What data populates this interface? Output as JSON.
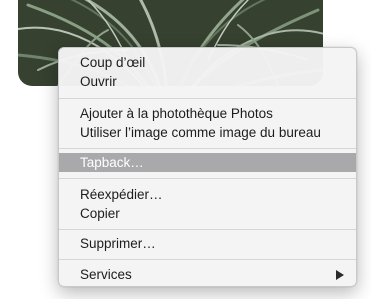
{
  "photo": {
    "icon": "plant-photo-thumbnail",
    "colors": {
      "dark": "#2f3a2a",
      "leaf": "#8fa58a",
      "light": "#c9d6c6"
    }
  },
  "menu": {
    "highlight_color": "#a9a9ab",
    "items": [
      {
        "label": "Coup d’œil"
      },
      {
        "label": "Ouvrir"
      },
      {
        "label": "Ajouter à la photothèque Photos"
      },
      {
        "label": "Utiliser l’image comme image du bureau"
      },
      {
        "label": "Tapback…",
        "highlighted": true
      },
      {
        "label": "Réexpédier…"
      },
      {
        "label": "Copier"
      },
      {
        "label": "Supprimer…"
      },
      {
        "label": "Services",
        "submenu_icon": "chevron-right-icon"
      }
    ]
  }
}
